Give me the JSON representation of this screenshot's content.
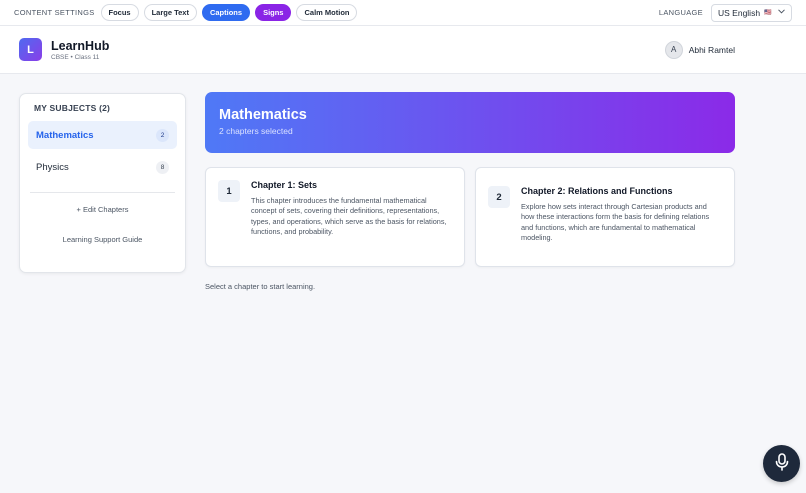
{
  "topbar": {
    "content_settings_label": "CONTENT SETTINGS",
    "pills": {
      "focus": "Focus",
      "large_text": "Large Text",
      "captions": "Captions",
      "signs": "Signs",
      "calm_motion": "Calm Motion"
    },
    "language_label": "LANGUAGE",
    "language_value": "US English",
    "language_flag": "🇺🇸"
  },
  "header": {
    "logo_letter": "L",
    "brand_name": "LearnHub",
    "brand_sub": "CBSE • Class 11",
    "user_initial": "A",
    "user_name": "Abhi Ramtel"
  },
  "sidebar": {
    "title": "MY SUBJECTS (2)",
    "items": [
      {
        "label": "Mathematics",
        "count": "2"
      },
      {
        "label": "Physics",
        "count": "8"
      }
    ],
    "edit_chapters": "+ Edit Chapters",
    "support_guide": "Learning Support Guide"
  },
  "main": {
    "banner_title": "Mathematics",
    "banner_sub": "2 chapters selected",
    "chapters": [
      {
        "number": "1",
        "title": "Chapter 1: Sets",
        "description": "This chapter introduces the fundamental mathematical concept of sets, covering their definitions, representations, types, and operations, which serve as the basis for relations, functions, and probability."
      },
      {
        "number": "2",
        "title": "Chapter 2: Relations and Functions",
        "description": "Explore how sets interact through Cartesian products and how these interactions form the basis for defining relations and functions, which are fundamental to mathematical modeling."
      }
    ],
    "hint": "Select a chapter to start learning."
  },
  "colors": {
    "accent_blue": "#2f6bf0",
    "accent_purple": "#8a24e6",
    "mic_button": "#1e293b"
  },
  "icons": {
    "mic": "microphone-icon",
    "chevron": "chevron-down-icon"
  }
}
